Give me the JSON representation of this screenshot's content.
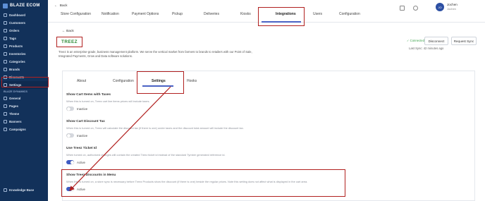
{
  "sidebar": {
    "brand": "BLAZE ECOM",
    "items": [
      {
        "label": "Dashboard",
        "icon": "dashboard-icon"
      },
      {
        "label": "Customers",
        "icon": "users-icon"
      },
      {
        "label": "Orders",
        "icon": "orders-icon"
      },
      {
        "label": "Tags",
        "icon": "tag-icon"
      },
      {
        "label": "Products",
        "icon": "products-icon"
      },
      {
        "label": "Inventories",
        "icon": "inventory-icon"
      },
      {
        "label": "Categories",
        "icon": "categories-icon"
      },
      {
        "label": "Brands",
        "icon": "brands-icon"
      },
      {
        "label": "Discounts",
        "icon": "discount-icon"
      },
      {
        "label": "Settings",
        "icon": "gear-icon"
      }
    ],
    "section_label": "BLAZE DYNAMICS",
    "dynamic_items": [
      {
        "label": "General",
        "icon": "general-icon"
      },
      {
        "label": "Pages",
        "icon": "pages-icon"
      },
      {
        "label": "Theme",
        "icon": "theme-icon"
      },
      {
        "label": "Banners",
        "icon": "banner-icon"
      },
      {
        "label": "Campaigns",
        "icon": "campaign-icon"
      }
    ],
    "knowledge_base": "Knowledge Base"
  },
  "topbar": {
    "back": "Back",
    "tabs": [
      "Store Configuration",
      "Notification",
      "Payment Options",
      "Pickup",
      "Deliveries",
      "Kiosks",
      "Integrations",
      "Users",
      "Configuration"
    ],
    "active_tab": "Integrations",
    "user": {
      "initials": "JO",
      "name": "Jochen",
      "sub": "Jochen"
    }
  },
  "integration": {
    "back": "Back",
    "logo": "TREEZ",
    "description_line1": "Treez is an enterprise-grade, business management platform. We serve the vertical market from farmers to brands to retailers with our Point of Sale,",
    "description_line2": "Integrated Payments, Grow and Data software solutions.",
    "status": "✓ Connected",
    "disconnect": "Disconnect",
    "request_sync": "Request Sync",
    "last_sync": "Last Sync: 42 minutes ago"
  },
  "subtabs": [
    "About",
    "Configuration",
    "Settings",
    "Hooks"
  ],
  "active_subtab": "Settings",
  "options": [
    {
      "title": "Show Cart Items with Taxes",
      "desc": "When this is turned on, Treez cart line items prices will include taxes.",
      "state": "Inactive",
      "on": false
    },
    {
      "title": "Show Cart Discount Tax",
      "desc": "When this is turned on, Treez will calculate the discount tax (if there is one) under taxes and the discount total amount will include the discount tax.",
      "state": "Inactive",
      "on": false
    },
    {
      "title": "Use Treez Ticket Id",
      "desc": "When turned on, authorized changes will contain the created Treez ticket id instead of the standard Tymber generated reference id.",
      "state": "Active",
      "on": true
    },
    {
      "title": "Show Treez Discounts in Menu",
      "desc": "When this is turned on, a store sync is necessary before Treez Products show the discount (if there is one) beside the regular prices. Note this setting does not affect what is displayed in the cart area.",
      "state": "Active",
      "on": true
    }
  ],
  "colors": {
    "sidebar": "#12315a",
    "highlight": "#b1201f",
    "accent": "#3e5bc2",
    "logo": "#2d8a36",
    "connected": "#3aa14a"
  }
}
